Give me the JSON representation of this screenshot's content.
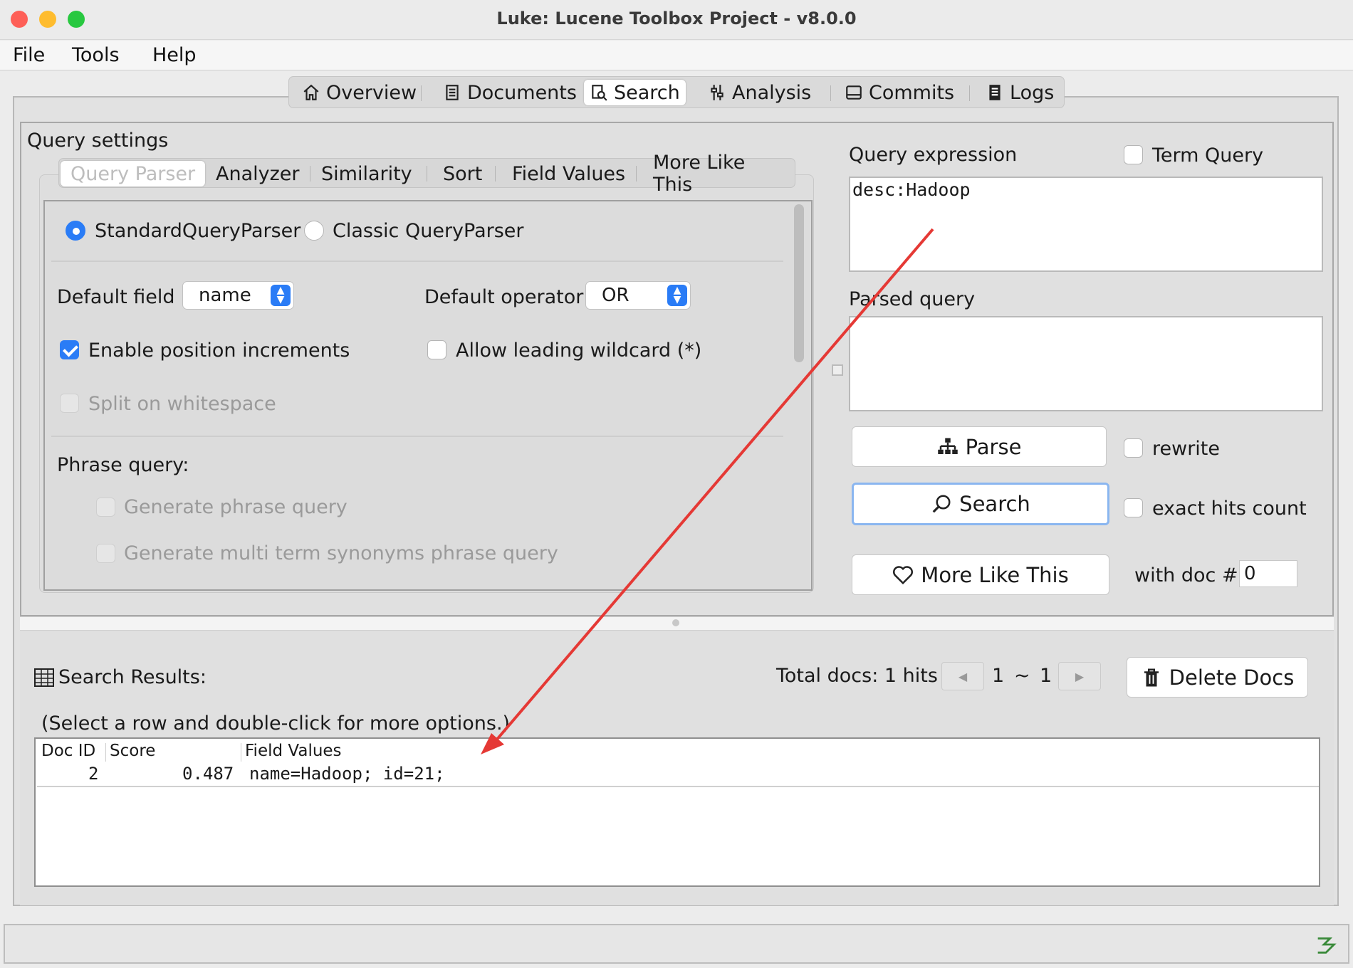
{
  "window": {
    "title": "Luke: Lucene Toolbox Project - v8.0.0"
  },
  "menu": {
    "file": "File",
    "tools": "Tools",
    "help": "Help"
  },
  "main_tabs": {
    "overview": "Overview",
    "documents": "Documents",
    "search": "Search",
    "analysis": "Analysis",
    "commits": "Commits",
    "logs": "Logs",
    "active": "Search"
  },
  "query_settings": {
    "title": "Query settings",
    "tabs": {
      "query_parser": "Query Parser",
      "analyzer": "Analyzer",
      "similarity": "Similarity",
      "sort": "Sort",
      "field_values": "Field Values",
      "more_like_this": "More Like This"
    },
    "parser": {
      "standard": "StandardQueryParser",
      "classic": "Classic QueryParser",
      "selected": "StandardQueryParser"
    },
    "default_field_label": "Default field",
    "default_field_value": "name",
    "default_operator_label": "Default operator",
    "default_operator_value": "OR",
    "enable_position_increments": "Enable position increments",
    "allow_leading_wildcard": "Allow leading wildcard (*)",
    "split_on_whitespace": "Split on whitespace",
    "phrase_query_label": "Phrase query:",
    "generate_phrase_query": "Generate phrase query",
    "generate_multi_term": "Generate multi term synonyms phrase query"
  },
  "query": {
    "expression_label": "Query expression",
    "term_query": "Term Query",
    "expression_value": "desc:Hadoop",
    "parsed_label": "Parsed query",
    "parsed_value": ""
  },
  "actions": {
    "parse": "Parse",
    "rewrite": "rewrite",
    "search": "Search",
    "exact_hits_count": "exact hits count",
    "more_like_this": "More Like This",
    "with_doc_label": "with doc #",
    "with_doc_value": "0"
  },
  "results": {
    "title": "Search Results:",
    "total_docs": "Total docs: 1 hits",
    "page_from": "1",
    "page_sep": "~",
    "page_to": "1",
    "delete_docs": "Delete Docs",
    "hint": "(Select a row and double-click for more options.)",
    "columns": [
      "Doc ID",
      "Score",
      "Field Values"
    ],
    "rows": [
      {
        "doc_id": "2",
        "score": "0.487",
        "field_values": "name=Hadoop; id=21;"
      }
    ]
  },
  "colors": {
    "accent": "#2a7cf6",
    "arrow": "#e53935"
  }
}
